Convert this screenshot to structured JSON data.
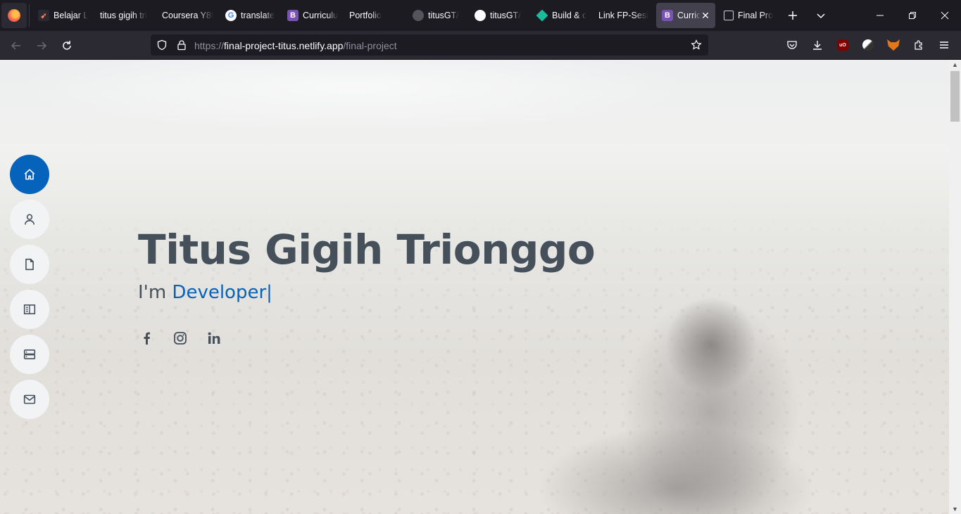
{
  "browser": {
    "tabs": [
      {
        "title": "Belajar L",
        "icon": "rocket-icon",
        "active": false
      },
      {
        "title": "titus gigih tri",
        "icon": "none",
        "active": false
      },
      {
        "title": "Coursera Y8f",
        "icon": "none",
        "active": false
      },
      {
        "title": "translate",
        "icon": "google-icon",
        "active": false
      },
      {
        "title": "Curriculu",
        "icon": "bootstrap-icon",
        "active": false
      },
      {
        "title": "Portfolio",
        "icon": "none",
        "active": false
      },
      {
        "title": "titusGT/",
        "icon": "github-icon",
        "active": false
      },
      {
        "title": "titusGT/",
        "icon": "github-icon",
        "active": false
      },
      {
        "title": "Build & c",
        "icon": "diamond-icon",
        "active": false
      },
      {
        "title": "Link FP-Sesi",
        "icon": "none",
        "active": false
      },
      {
        "title": "Curric",
        "icon": "bootstrap-icon",
        "active": true
      },
      {
        "title": "Final Pro",
        "icon": "person-card-icon",
        "active": false
      }
    ],
    "url": {
      "scheme": "https://",
      "host": "final-project-titus.netlify.app",
      "path": "/final-project"
    }
  },
  "page": {
    "name": "Titus Gigih Trionggo",
    "intro_prefix": "I'm",
    "role": "Developer",
    "cursor": "|",
    "accent_color": "#0563bb",
    "text_color": "#45505b",
    "side_nav": [
      {
        "icon": "home-icon",
        "active": true
      },
      {
        "icon": "person-icon",
        "active": false
      },
      {
        "icon": "file-icon",
        "active": false
      },
      {
        "icon": "book-icon",
        "active": false
      },
      {
        "icon": "server-icon",
        "active": false
      },
      {
        "icon": "envelope-icon",
        "active": false
      }
    ],
    "social": [
      "facebook-icon",
      "instagram-icon",
      "linkedin-icon"
    ]
  }
}
